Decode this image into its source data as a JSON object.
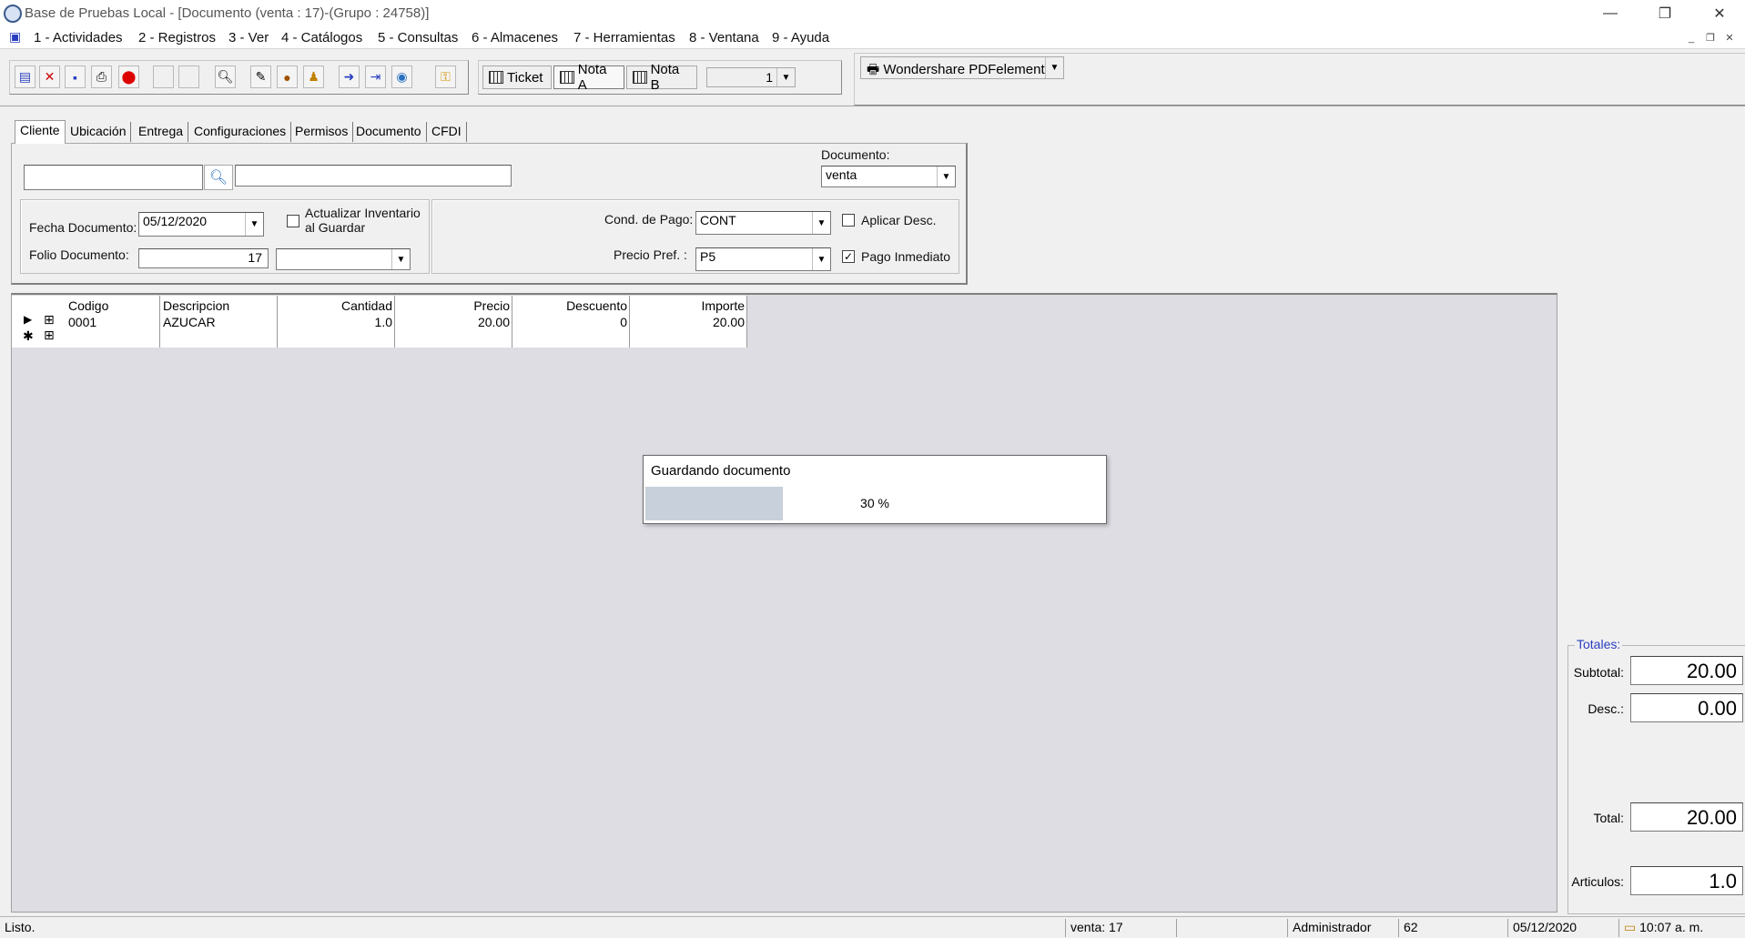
{
  "window": {
    "title": "Base de Pruebas Local - [Documento (venta : 17)-(Grupo : 24758)]",
    "minimize": "—",
    "maximize": "❐",
    "close": "✕"
  },
  "menu": {
    "items": [
      "1 - Actividades",
      "2 - Registros",
      "3 - Ver",
      "4 - Catálogos",
      "5 - Consultas",
      "6 - Almacenes",
      "7 - Herramientas",
      "8 - Ventana",
      "9 - Ayuda"
    ]
  },
  "toolbar": {
    "ticket_label": "Ticket",
    "nota_a_label": "Nota A",
    "nota_b_label": "Nota B",
    "copies_value": "1",
    "printer_label": "Wondershare PDFelement"
  },
  "tabs": [
    "Cliente",
    "Ubicación",
    "Entrega",
    "Configuraciones",
    "Permisos",
    "Documento",
    "CFDI"
  ],
  "form": {
    "cliente_codigo": "",
    "cliente_nombre": "",
    "documento_label": "Documento:",
    "documento_value": "venta",
    "fecha_label": "Fecha Documento:",
    "fecha_value": "05/12/2020",
    "folio_label": "Folio Documento:",
    "folio_value": "17",
    "folio_serie": "",
    "actualizar_label_1": "Actualizar Inventario",
    "actualizar_label_2": "al Guardar",
    "actualizar_checked": false,
    "cond_pago_label": "Cond. de Pago:",
    "cond_pago_value": "CONT",
    "precio_pref_label": "Precio Pref. :",
    "precio_pref_value": "P5",
    "aplicar_desc_label": "Aplicar Desc.",
    "aplicar_desc_checked": false,
    "pago_inmediato_label": "Pago Inmediato",
    "pago_inmediato_checked": true
  },
  "grid": {
    "columns": [
      "Codigo",
      "Descripcion",
      "Cantidad",
      "Precio",
      "Descuento",
      "Importe"
    ],
    "rows": [
      {
        "codigo": "0001",
        "descripcion": "AZUCAR",
        "cantidad": "1.0",
        "precio": "20.00",
        "descuento": "0",
        "importe": "20.00"
      }
    ]
  },
  "progress": {
    "title": "Guardando documento",
    "percent_text": "30 %",
    "percent": 30
  },
  "totals": {
    "group_label": "Totales:",
    "subtotal_label": "Subtotal:",
    "subtotal": "20.00",
    "desc_label": "Desc.:",
    "desc": "0.00",
    "total_label": "Total:",
    "total": "20.00",
    "articulos_label": "Articulos:",
    "articulos": "1.0"
  },
  "status": {
    "message": "Listo.",
    "documento": "venta:  17",
    "user": "Administrador",
    "code": "62",
    "date": "05/12/2020",
    "time": "10:07 a. m."
  },
  "colors": {
    "accent": "#2a3fbf",
    "progress_fill": "#c7d0db",
    "grid_background": "#dddde3"
  }
}
